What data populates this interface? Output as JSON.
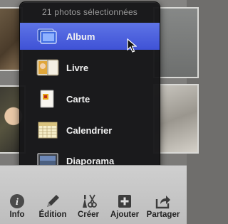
{
  "popover": {
    "header": "21 photos sélectionnées",
    "items": [
      {
        "label": "Album",
        "icon": "album-icon",
        "selected": true
      },
      {
        "label": "Livre",
        "icon": "book-icon",
        "selected": false
      },
      {
        "label": "Carte",
        "icon": "card-icon",
        "selected": false
      },
      {
        "label": "Calendrier",
        "icon": "calendar-icon",
        "selected": false
      },
      {
        "label": "Diaporama",
        "icon": "slideshow-icon",
        "selected": false
      }
    ]
  },
  "toolbar": {
    "buttons": [
      {
        "label": "Info",
        "icon": "info-icon"
      },
      {
        "label": "Édition",
        "icon": "pencil-icon"
      },
      {
        "label": "Créer",
        "icon": "create-tools-icon"
      },
      {
        "label": "Ajouter",
        "icon": "add-icon"
      },
      {
        "label": "Partager",
        "icon": "share-icon"
      }
    ]
  },
  "colors": {
    "selection": "#4a5fdd",
    "popover_bg": "#161618",
    "toolbar_bg": "#c6c6c6"
  }
}
